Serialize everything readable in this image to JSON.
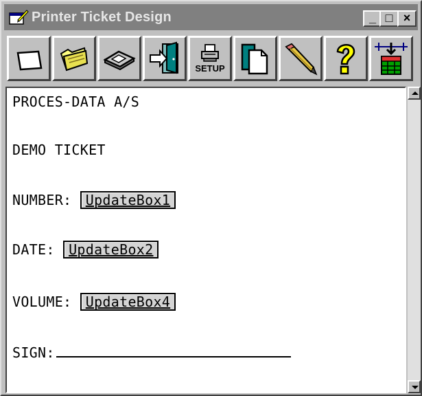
{
  "window": {
    "title": "Printer Ticket Design",
    "minimize_label": "_",
    "maximize_label": "□",
    "close_label": "×"
  },
  "toolbar": {
    "setup_label": "SETUP",
    "tools": [
      {
        "icon": "new-page-icon"
      },
      {
        "icon": "open-folder-icon"
      },
      {
        "icon": "save-disk-icon"
      },
      {
        "icon": "exit-door-icon"
      },
      {
        "icon": "printer-setup-icon"
      },
      {
        "icon": "copy-pages-icon"
      },
      {
        "icon": "pencil-icon"
      },
      {
        "icon": "help-question-icon"
      },
      {
        "icon": "insert-field-icon"
      }
    ]
  },
  "ticket": {
    "company": "PROCES-DATA A/S",
    "heading": "DEMO TICKET",
    "number_label": "NUMBER:",
    "number_field": "UpdateBox1",
    "date_label": "DATE:",
    "date_field": "UpdateBox2",
    "volume_label": "VOLUME:",
    "volume_field": "UpdateBox4",
    "sign_label": "SIGN:"
  }
}
